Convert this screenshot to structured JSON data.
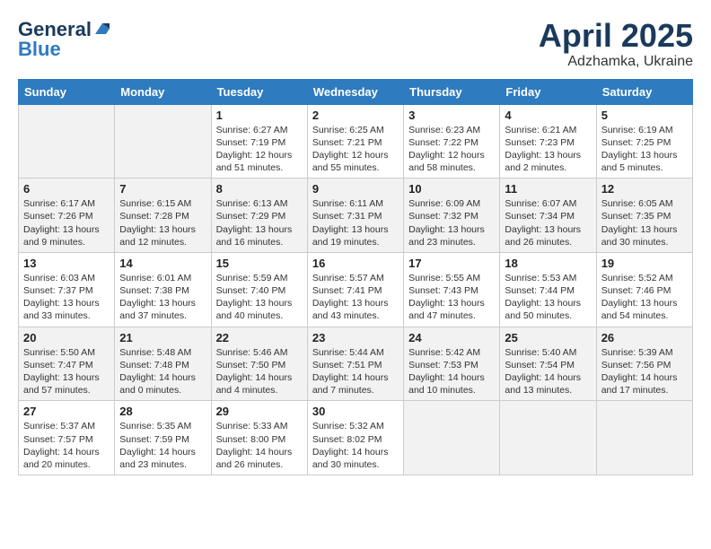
{
  "header": {
    "logo_general": "General",
    "logo_blue": "Blue",
    "month": "April 2025",
    "location": "Adzhamka, Ukraine"
  },
  "days_of_week": [
    "Sunday",
    "Monday",
    "Tuesday",
    "Wednesday",
    "Thursday",
    "Friday",
    "Saturday"
  ],
  "weeks": [
    [
      {
        "day": "",
        "empty": true
      },
      {
        "day": "",
        "empty": true
      },
      {
        "day": "1",
        "sunrise": "Sunrise: 6:27 AM",
        "sunset": "Sunset: 7:19 PM",
        "daylight": "Daylight: 12 hours and 51 minutes."
      },
      {
        "day": "2",
        "sunrise": "Sunrise: 6:25 AM",
        "sunset": "Sunset: 7:21 PM",
        "daylight": "Daylight: 12 hours and 55 minutes."
      },
      {
        "day": "3",
        "sunrise": "Sunrise: 6:23 AM",
        "sunset": "Sunset: 7:22 PM",
        "daylight": "Daylight: 12 hours and 58 minutes."
      },
      {
        "day": "4",
        "sunrise": "Sunrise: 6:21 AM",
        "sunset": "Sunset: 7:23 PM",
        "daylight": "Daylight: 13 hours and 2 minutes."
      },
      {
        "day": "5",
        "sunrise": "Sunrise: 6:19 AM",
        "sunset": "Sunset: 7:25 PM",
        "daylight": "Daylight: 13 hours and 5 minutes."
      }
    ],
    [
      {
        "day": "6",
        "sunrise": "Sunrise: 6:17 AM",
        "sunset": "Sunset: 7:26 PM",
        "daylight": "Daylight: 13 hours and 9 minutes."
      },
      {
        "day": "7",
        "sunrise": "Sunrise: 6:15 AM",
        "sunset": "Sunset: 7:28 PM",
        "daylight": "Daylight: 13 hours and 12 minutes."
      },
      {
        "day": "8",
        "sunrise": "Sunrise: 6:13 AM",
        "sunset": "Sunset: 7:29 PM",
        "daylight": "Daylight: 13 hours and 16 minutes."
      },
      {
        "day": "9",
        "sunrise": "Sunrise: 6:11 AM",
        "sunset": "Sunset: 7:31 PM",
        "daylight": "Daylight: 13 hours and 19 minutes."
      },
      {
        "day": "10",
        "sunrise": "Sunrise: 6:09 AM",
        "sunset": "Sunset: 7:32 PM",
        "daylight": "Daylight: 13 hours and 23 minutes."
      },
      {
        "day": "11",
        "sunrise": "Sunrise: 6:07 AM",
        "sunset": "Sunset: 7:34 PM",
        "daylight": "Daylight: 13 hours and 26 minutes."
      },
      {
        "day": "12",
        "sunrise": "Sunrise: 6:05 AM",
        "sunset": "Sunset: 7:35 PM",
        "daylight": "Daylight: 13 hours and 30 minutes."
      }
    ],
    [
      {
        "day": "13",
        "sunrise": "Sunrise: 6:03 AM",
        "sunset": "Sunset: 7:37 PM",
        "daylight": "Daylight: 13 hours and 33 minutes."
      },
      {
        "day": "14",
        "sunrise": "Sunrise: 6:01 AM",
        "sunset": "Sunset: 7:38 PM",
        "daylight": "Daylight: 13 hours and 37 minutes."
      },
      {
        "day": "15",
        "sunrise": "Sunrise: 5:59 AM",
        "sunset": "Sunset: 7:40 PM",
        "daylight": "Daylight: 13 hours and 40 minutes."
      },
      {
        "day": "16",
        "sunrise": "Sunrise: 5:57 AM",
        "sunset": "Sunset: 7:41 PM",
        "daylight": "Daylight: 13 hours and 43 minutes."
      },
      {
        "day": "17",
        "sunrise": "Sunrise: 5:55 AM",
        "sunset": "Sunset: 7:43 PM",
        "daylight": "Daylight: 13 hours and 47 minutes."
      },
      {
        "day": "18",
        "sunrise": "Sunrise: 5:53 AM",
        "sunset": "Sunset: 7:44 PM",
        "daylight": "Daylight: 13 hours and 50 minutes."
      },
      {
        "day": "19",
        "sunrise": "Sunrise: 5:52 AM",
        "sunset": "Sunset: 7:46 PM",
        "daylight": "Daylight: 13 hours and 54 minutes."
      }
    ],
    [
      {
        "day": "20",
        "sunrise": "Sunrise: 5:50 AM",
        "sunset": "Sunset: 7:47 PM",
        "daylight": "Daylight: 13 hours and 57 minutes."
      },
      {
        "day": "21",
        "sunrise": "Sunrise: 5:48 AM",
        "sunset": "Sunset: 7:48 PM",
        "daylight": "Daylight: 14 hours and 0 minutes."
      },
      {
        "day": "22",
        "sunrise": "Sunrise: 5:46 AM",
        "sunset": "Sunset: 7:50 PM",
        "daylight": "Daylight: 14 hours and 4 minutes."
      },
      {
        "day": "23",
        "sunrise": "Sunrise: 5:44 AM",
        "sunset": "Sunset: 7:51 PM",
        "daylight": "Daylight: 14 hours and 7 minutes."
      },
      {
        "day": "24",
        "sunrise": "Sunrise: 5:42 AM",
        "sunset": "Sunset: 7:53 PM",
        "daylight": "Daylight: 14 hours and 10 minutes."
      },
      {
        "day": "25",
        "sunrise": "Sunrise: 5:40 AM",
        "sunset": "Sunset: 7:54 PM",
        "daylight": "Daylight: 14 hours and 13 minutes."
      },
      {
        "day": "26",
        "sunrise": "Sunrise: 5:39 AM",
        "sunset": "Sunset: 7:56 PM",
        "daylight": "Daylight: 14 hours and 17 minutes."
      }
    ],
    [
      {
        "day": "27",
        "sunrise": "Sunrise: 5:37 AM",
        "sunset": "Sunset: 7:57 PM",
        "daylight": "Daylight: 14 hours and 20 minutes."
      },
      {
        "day": "28",
        "sunrise": "Sunrise: 5:35 AM",
        "sunset": "Sunset: 7:59 PM",
        "daylight": "Daylight: 14 hours and 23 minutes."
      },
      {
        "day": "29",
        "sunrise": "Sunrise: 5:33 AM",
        "sunset": "Sunset: 8:00 PM",
        "daylight": "Daylight: 14 hours and 26 minutes."
      },
      {
        "day": "30",
        "sunrise": "Sunrise: 5:32 AM",
        "sunset": "Sunset: 8:02 PM",
        "daylight": "Daylight: 14 hours and 30 minutes."
      },
      {
        "day": "",
        "empty": true
      },
      {
        "day": "",
        "empty": true
      },
      {
        "day": "",
        "empty": true
      }
    ]
  ]
}
